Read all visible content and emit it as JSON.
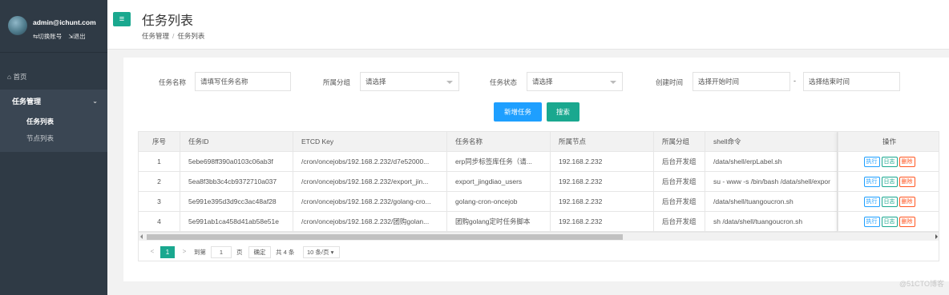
{
  "user": {
    "email": "admin@ichunt.com",
    "switch_account": "⇆切换账号",
    "logout": "⇲退出"
  },
  "nav": {
    "home": "⌂ 首页",
    "group_title": "任务管理",
    "items": [
      {
        "label": "任务列表",
        "active": true
      },
      {
        "label": "节点列表",
        "active": false
      }
    ]
  },
  "header": {
    "menu_icon": "≡",
    "title": "任务列表",
    "breadcrumb": [
      "任务管理",
      "任务列表"
    ],
    "breadcrumb_sep": "/"
  },
  "filters": {
    "task_name_label": "任务名称",
    "task_name_placeholder": "请填写任务名称",
    "group_label": "所属分组",
    "group_value": "请选择",
    "status_label": "任务状态",
    "status_value": "请选择",
    "created_label": "创建时间",
    "start_placeholder": "选择开始时间",
    "range_sep": "-",
    "end_placeholder": "选择结束时间"
  },
  "buttons": {
    "add": "新增任务",
    "search": "搜索"
  },
  "table": {
    "headers": [
      "序号",
      "任务ID",
      "ETCD Key",
      "任务名称",
      "所属节点",
      "所属分组",
      "shell命令",
      "操作"
    ],
    "rows": [
      [
        "1",
        "5ebe698ff390a0103c06ab3f",
        "/cron/oncejobs/192.168.2.232/d7e52000...",
        "erp同步标签库任务（请...",
        "192.168.2.232",
        "后台开发组",
        "/data/shell/erpLabel.sh"
      ],
      [
        "2",
        "5ea8f3bb3c4cb9372710a037",
        "/cron/oncejobs/192.168.2.232/export_jin...",
        "export_jingdiao_users",
        "192.168.2.232",
        "后台开发组",
        "su - www -s /bin/bash /data/shell/expor"
      ],
      [
        "3",
        "5e991e395d3d9cc3ac48af28",
        "/cron/oncejobs/192.168.2.232/golang-cro...",
        "golang-cron-oncejob",
        "192.168.2.232",
        "后台开发组",
        "/data/shell/tuangoucron.sh"
      ],
      [
        "4",
        "5e991ab1ca458d41ab58e51e",
        "/cron/oncejobs/192.168.2.232/团购golan...",
        "团购golang定时任务脚本",
        "192.168.2.232",
        "后台开发组",
        "sh /data/shell/tuangoucron.sh"
      ]
    ],
    "actions": {
      "run": "执行",
      "log": "日志",
      "delete": "删除"
    }
  },
  "pager": {
    "prev": "<",
    "current": "1",
    "next": ">",
    "goto_label": "到第",
    "goto_value": "1",
    "page_unit": "页",
    "confirm": "确定",
    "total": "共 4 条",
    "page_size": "10 条/页 ▾"
  },
  "watermark": "@51CTO博客",
  "colors": {
    "sidebar": "#2f3a45",
    "accent_green": "#1aa88f",
    "accent_blue": "#1e9fff",
    "danger": "#ff5722"
  }
}
